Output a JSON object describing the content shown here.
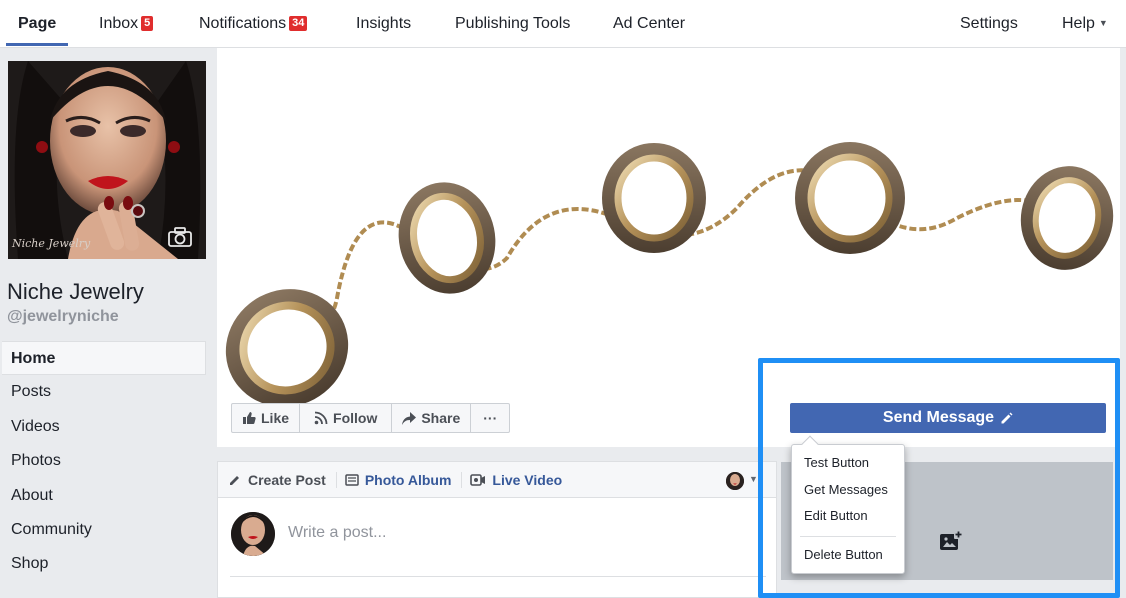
{
  "topbar": {
    "tabs": [
      {
        "label": "Page",
        "active": true
      },
      {
        "label": "Inbox",
        "badge": "5"
      },
      {
        "label": "Notifications",
        "badge": "34"
      },
      {
        "label": "Insights"
      },
      {
        "label": "Publishing Tools"
      },
      {
        "label": "Ad Center"
      }
    ],
    "right": [
      {
        "label": "Settings"
      },
      {
        "label": "Help"
      }
    ]
  },
  "profile": {
    "name": "Niche Jewelry",
    "handle": "@jewelryniche",
    "logo_text": "Niche Jewelry"
  },
  "sidebar": {
    "items": [
      {
        "label": "Home",
        "active": true
      },
      {
        "label": "Posts"
      },
      {
        "label": "Videos"
      },
      {
        "label": "Photos"
      },
      {
        "label": "About"
      },
      {
        "label": "Community"
      },
      {
        "label": "Shop"
      }
    ]
  },
  "actions": {
    "like": "Like",
    "follow": "Follow",
    "share": "Share",
    "more": "···"
  },
  "composer": {
    "tabs": [
      "Create Post",
      "Photo Album",
      "Live Video"
    ],
    "placeholder": "Write a post..."
  },
  "cta": {
    "label": "Send Message",
    "menu": [
      "Test Button",
      "Get Messages",
      "Edit Button",
      "Delete Button"
    ]
  },
  "colors": {
    "brand": "#4267b2",
    "highlight": "#1f8ff5",
    "badge": "#e02d2d"
  }
}
